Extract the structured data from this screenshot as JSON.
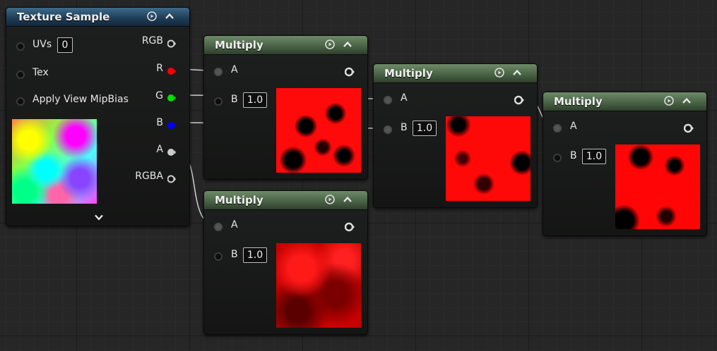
{
  "texture_sample": {
    "title": "Texture Sample",
    "inputs": [
      {
        "label": "UVs",
        "value": "0"
      },
      {
        "label": "Tex"
      },
      {
        "label": "Apply View MipBias"
      }
    ],
    "outputs": [
      "RGB",
      "R",
      "G",
      "B",
      "A",
      "RGBA"
    ],
    "pin_colors": {
      "R": "#ff0000",
      "G": "#00dd00",
      "B": "#0000ff",
      "A": "#cccccc"
    }
  },
  "multiply_nodes": [
    {
      "title": "Multiply",
      "input_a": "A",
      "input_b": "B",
      "b_value": "1.0"
    },
    {
      "title": "Multiply",
      "input_a": "A",
      "input_b": "B",
      "b_value": "1.0"
    },
    {
      "title": "Multiply",
      "input_a": "A",
      "input_b": "B",
      "b_value": "1.0"
    },
    {
      "title": "Multiply",
      "input_a": "A",
      "input_b": "B",
      "b_value": "1.0"
    }
  ],
  "icons": {
    "preview_toggle": "play-circle-icon",
    "collapse": "chevron-up-icon",
    "expand": "chevron-down-icon"
  },
  "colors": {
    "header_blue": "#2a5270",
    "header_green": "#4a6446",
    "canvas_bg": "#262626"
  }
}
